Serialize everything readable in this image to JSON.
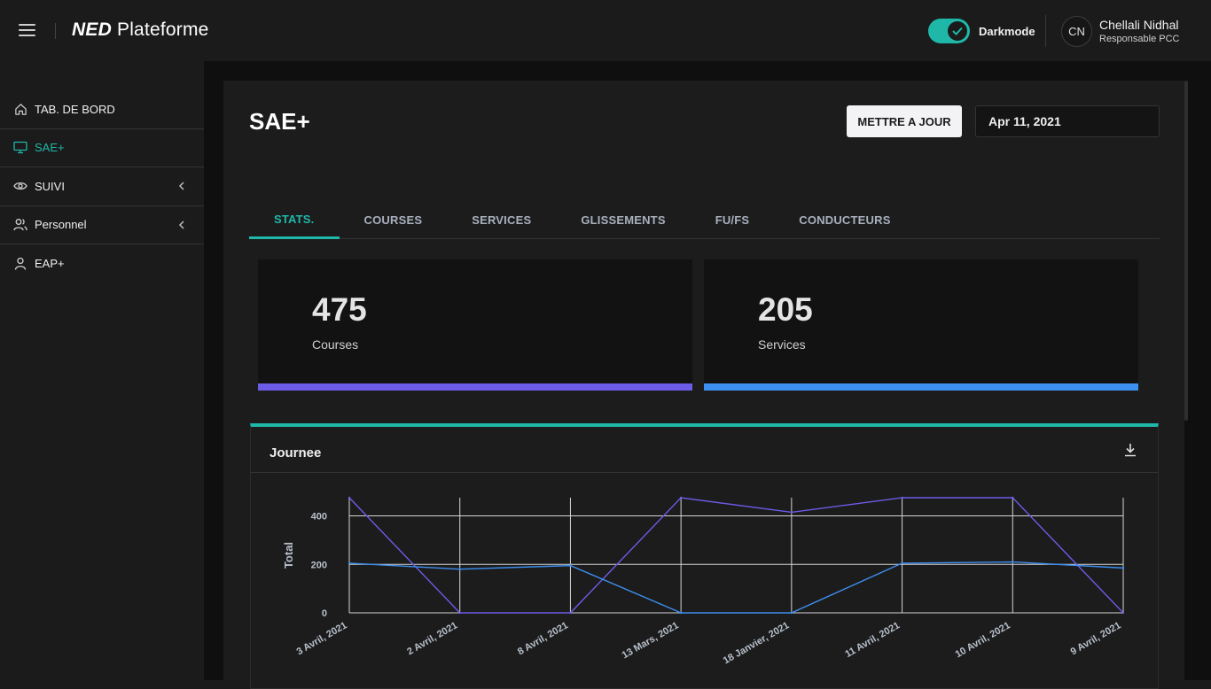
{
  "app": {
    "brand_bold": "NED",
    "brand_rest": " Plateforme"
  },
  "header": {
    "darkmode_label": "Darkmode",
    "darkmode_on": true,
    "avatar_initials": "CN",
    "user_name": "Chellali Nidhal",
    "user_role": "Responsable PCC"
  },
  "sidebar": {
    "items": [
      {
        "label": "TAB. DE BORD",
        "icon": "home-icon",
        "active": false,
        "has_children": false
      },
      {
        "label": "SAE+",
        "icon": "monitor-icon",
        "active": true,
        "has_children": false
      },
      {
        "label": "SUIVI",
        "icon": "eye-icon",
        "active": false,
        "has_children": true
      },
      {
        "label": "Personnel",
        "icon": "users-icon",
        "active": false,
        "has_children": true
      },
      {
        "label": "EAP+",
        "icon": "user-icon",
        "active": false,
        "has_children": false
      }
    ]
  },
  "main": {
    "title": "SAE+",
    "update_button": "METTRE A JOUR",
    "date_value": "Apr 11, 2021",
    "tabs": [
      {
        "label": "STATS.",
        "active": true
      },
      {
        "label": "COURSES",
        "active": false
      },
      {
        "label": "SERVICES",
        "active": false
      },
      {
        "label": "GLISSEMENTS",
        "active": false
      },
      {
        "label": "FU/FS",
        "active": false
      },
      {
        "label": "CONDUCTEURS",
        "active": false
      }
    ],
    "stats": [
      {
        "value": "475",
        "label": "Courses",
        "color": "#6c5ce7"
      },
      {
        "value": "205",
        "label": "Services",
        "color": "#3d8ff0"
      }
    ],
    "chart_card_title": "Journee"
  },
  "colors": {
    "accent": "#1fb8a8",
    "courses": "#6c5ce7",
    "services": "#3d8ff0"
  },
  "chart_data": {
    "type": "line",
    "title": "Journee",
    "xlabel": "",
    "ylabel": "Total",
    "categories": [
      "3 Avril, 2021",
      "2 Avril, 2021",
      "8 Avril, 2021",
      "13 Mars, 2021",
      "18 Janvier, 2021",
      "11 Avril, 2021",
      "10 Avril, 2021",
      "9 Avril, 2021"
    ],
    "y_ticks": [
      "0",
      "200",
      "400"
    ],
    "ylim": [
      0,
      475
    ],
    "grid": true,
    "series": [
      {
        "name": "Courses",
        "color": "#6c5ce7",
        "values": [
          475,
          0,
          0,
          475,
          415,
          475,
          475,
          0
        ]
      },
      {
        "name": "Services",
        "color": "#3d8ff0",
        "values": [
          205,
          180,
          195,
          0,
          0,
          205,
          210,
          185
        ]
      }
    ]
  }
}
